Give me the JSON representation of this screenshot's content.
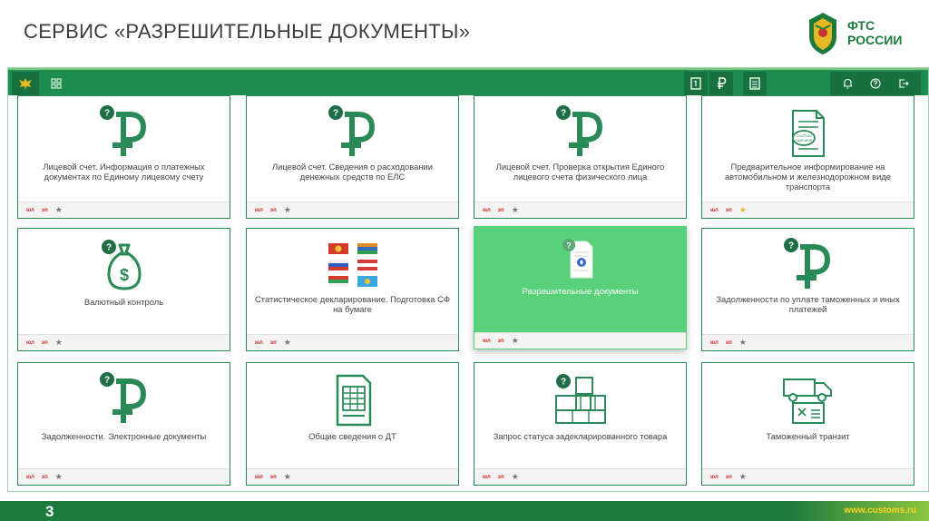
{
  "slide": {
    "title": "СЕРВИС «РАЗРЕШИТЕЛЬНЫЕ ДОКУМЕНТЫ»",
    "logo_line1": "ФТС",
    "logo_line2": "РОССИИ",
    "page_number": "3",
    "site_url": "www.customs.ru"
  },
  "colors": {
    "brand_green": "#1e8c4e",
    "active_tile": "#59d17a",
    "badge_red": "#d62c2c",
    "star_gold": "#e9b31c"
  },
  "navbar": {
    "left_icons": [
      "eagle-emblem-icon",
      "grid-icon"
    ],
    "center_icons": [
      "document-1-icon",
      "ruble-icon",
      "spreadsheet-icon"
    ],
    "right_icons": [
      "bell-icon",
      "help-icon",
      "logout-icon"
    ]
  },
  "tiles": [
    {
      "label": "Лицевой счет. Информация о платежных документах по Единому лицевому счету",
      "icon": "ruble-question-icon",
      "badge1": "юл",
      "badge2": "эп",
      "star": "grey"
    },
    {
      "label": "Лицевой счет. Сведения о расходовании денежных средств по ЕЛС",
      "icon": "ruble-question-icon",
      "badge1": "юл",
      "badge2": "эп",
      "star": "grey"
    },
    {
      "label": "Лицевой счет. Проверка открытия Единого лицевого счета физического лица",
      "icon": "ruble-question-icon",
      "badge1": "юл",
      "badge2": "эп",
      "star": "grey"
    },
    {
      "label": "Предварительное информирование на автомобильном и железнодорожном виде транспорта",
      "icon": "customs-declaration-icon",
      "badge1": "юл",
      "badge2": "эп",
      "star": "gold"
    },
    {
      "label": "Валютный контроль",
      "icon": "money-bag-icon",
      "badge1": "юл",
      "badge2": "эп",
      "star": "grey"
    },
    {
      "label": "Статистическое декларирование. Подготовка СФ на бумаге",
      "icon": "flags-icon",
      "badge1": "юл",
      "badge2": "эп",
      "star": "grey"
    },
    {
      "label": "Разрешительные документы",
      "icon": "permit-document-icon",
      "badge1": "юл",
      "badge2": "эп",
      "star": "grey",
      "active": true
    },
    {
      "label": "Задолженности по уплате таможенных и иных платежей",
      "icon": "ruble-question-icon",
      "badge1": "юл",
      "badge2": "эп",
      "star": "grey"
    },
    {
      "label": "Задолженности. Электронные документы",
      "icon": "ruble-question-icon",
      "badge1": "юл",
      "badge2": "эп",
      "star": "grey"
    },
    {
      "label": "Общие сведения о ДТ",
      "icon": "table-document-icon",
      "badge1": "юл",
      "badge2": "эп",
      "star": "grey"
    },
    {
      "label": "Запрос статуса задекларированного товара",
      "icon": "boxes-question-icon",
      "badge1": "юл",
      "badge2": "эп",
      "star": "grey"
    },
    {
      "label": "Таможенный транзит",
      "icon": "truck-document-icon",
      "badge1": "юл",
      "badge2": "эп",
      "star": "grey"
    }
  ]
}
